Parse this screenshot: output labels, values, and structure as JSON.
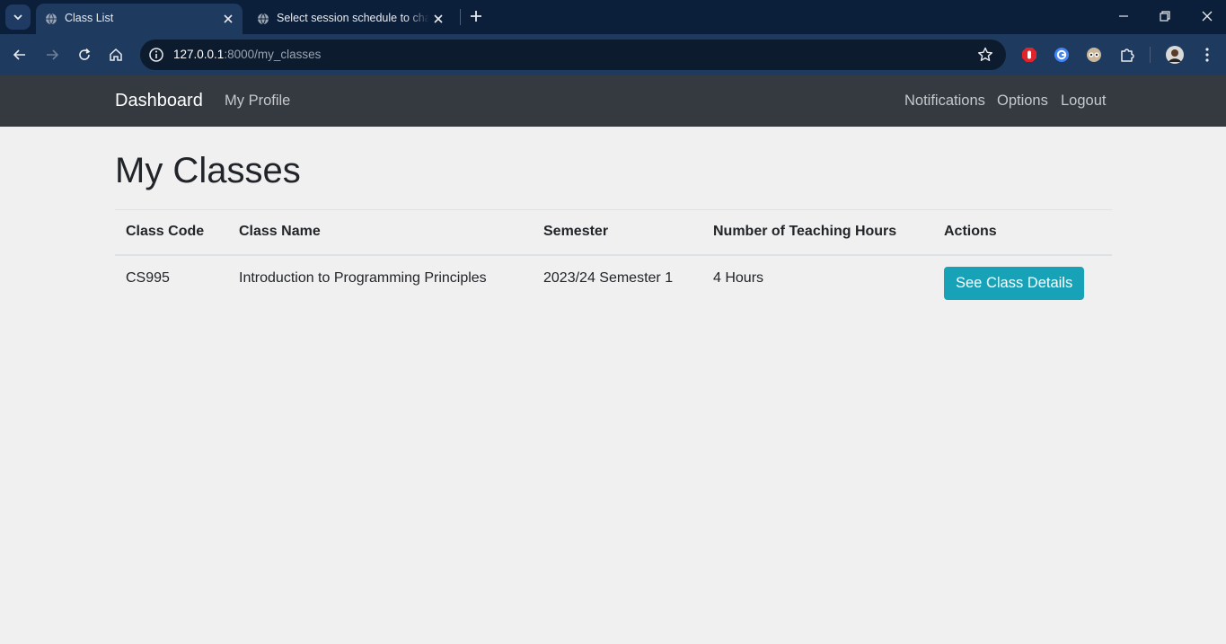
{
  "browser": {
    "tabs": [
      {
        "title": "Class List",
        "active": true
      },
      {
        "title": "Select session schedule to change",
        "active": false
      }
    ],
    "url_host": "127.0.0.1",
    "url_rest": ":8000/my_classes"
  },
  "navbar": {
    "brand": "Dashboard",
    "left_links": [
      "My Profile"
    ],
    "right_links": [
      "Notifications",
      "Options",
      "Logout"
    ]
  },
  "page": {
    "title": "My Classes"
  },
  "table": {
    "headers": [
      "Class Code",
      "Class Name",
      "Semester",
      "Number of Teaching Hours",
      "Actions"
    ],
    "rows": [
      {
        "code": "CS995",
        "name": "Introduction to Programming Principles",
        "semester": "2023/24 Semester 1",
        "hours": "4 Hours",
        "action_label": "See Class Details"
      }
    ]
  },
  "colors": {
    "navbar_bg": "#343a40",
    "button_info": "#17a2b8",
    "page_bg": "#f0f0f0"
  }
}
